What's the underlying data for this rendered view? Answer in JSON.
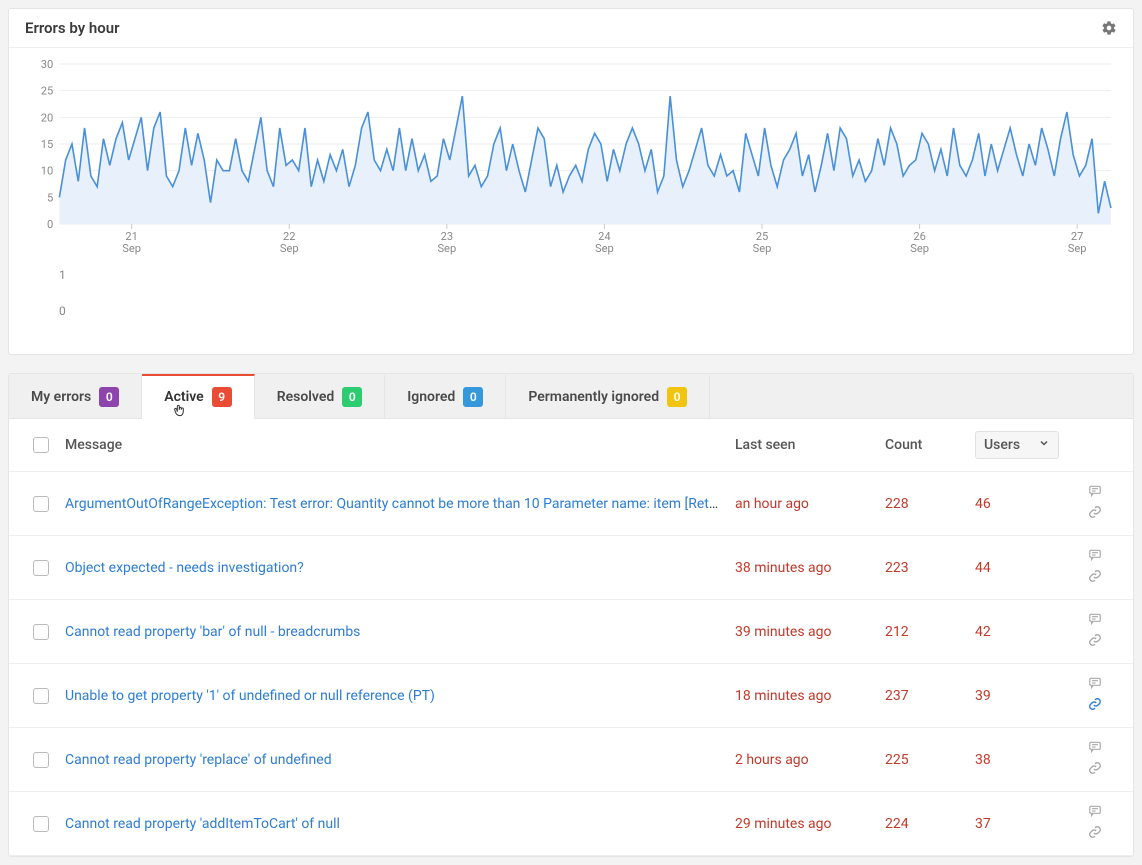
{
  "chart": {
    "title": "Errors by hour"
  },
  "chart_data": {
    "type": "line",
    "title": "Errors by hour",
    "ylabel": "",
    "xlabel": "",
    "ylim": [
      0,
      30
    ],
    "y_ticks": [
      0,
      5,
      10,
      15,
      20,
      25,
      30
    ],
    "x_ticks": [
      {
        "label_top": "21",
        "label_bottom": "Sep"
      },
      {
        "label_top": "22",
        "label_bottom": "Sep"
      },
      {
        "label_top": "23",
        "label_bottom": "Sep"
      },
      {
        "label_top": "24",
        "label_bottom": "Sep"
      },
      {
        "label_top": "25",
        "label_bottom": "Sep"
      },
      {
        "label_top": "26",
        "label_bottom": "Sep"
      },
      {
        "label_top": "27",
        "label_bottom": "Sep"
      }
    ],
    "secondary_axis_ticks": [
      "1",
      "0"
    ],
    "series": [
      {
        "name": "errors",
        "values": [
          5,
          12,
          15,
          8,
          18,
          9,
          7,
          16,
          11,
          16,
          19,
          12,
          16,
          20,
          10,
          18,
          21,
          9,
          7,
          10,
          18,
          11,
          17,
          12,
          4,
          12,
          10,
          10,
          16,
          10,
          8,
          14,
          20,
          10,
          7,
          18,
          11,
          12,
          10,
          18,
          7,
          12,
          8,
          13,
          10,
          14,
          7,
          11,
          18,
          21,
          12,
          10,
          14,
          10,
          18,
          10,
          16,
          10,
          13,
          8,
          9,
          16,
          12,
          18,
          24,
          9,
          11,
          7,
          9,
          15,
          18,
          10,
          15,
          10,
          6,
          12,
          18,
          16,
          7,
          11,
          6,
          9,
          11,
          8,
          14,
          17,
          15,
          8,
          14,
          10,
          15,
          18,
          15,
          10,
          14,
          6,
          9,
          24,
          12,
          7,
          10,
          14,
          18,
          11,
          9,
          13,
          9,
          10,
          6,
          17,
          13,
          9,
          18,
          11,
          7,
          12,
          14,
          17,
          9,
          13,
          6,
          11,
          17,
          10,
          18,
          16,
          9,
          12,
          8,
          10,
          16,
          11,
          18,
          15,
          9,
          11,
          12,
          17,
          15,
          10,
          14,
          9,
          18,
          11,
          9,
          12,
          17,
          9,
          15,
          10,
          14,
          18,
          13,
          9,
          15,
          11,
          18,
          14,
          9,
          16,
          21,
          13,
          9,
          11,
          16,
          2,
          8,
          3
        ]
      }
    ]
  },
  "tabs": [
    {
      "id": "my-errors",
      "label": "My errors",
      "badge": "0",
      "badge_color": "purple",
      "active": false
    },
    {
      "id": "active",
      "label": "Active",
      "badge": "9",
      "badge_color": "red",
      "active": true
    },
    {
      "id": "resolved",
      "label": "Resolved",
      "badge": "0",
      "badge_color": "green",
      "active": false
    },
    {
      "id": "ignored",
      "label": "Ignored",
      "badge": "0",
      "badge_color": "blue",
      "active": false
    },
    {
      "id": "perm-ignored",
      "label": "Permanently ignored",
      "badge": "0",
      "badge_color": "orange",
      "active": false
    }
  ],
  "table": {
    "headers": {
      "message": "Message",
      "last_seen": "Last seen",
      "count": "Count",
      "users": "Users"
    },
    "rows": [
      {
        "message": "ArgumentOutOfRangeException: Test error: Quantity cannot be more than 10 Parameter name: item [Returned …",
        "last_seen": "an hour ago",
        "count": "228",
        "users": "46",
        "link_highlight": false
      },
      {
        "message": "Object expected - needs investigation?",
        "last_seen": "38 minutes ago",
        "count": "223",
        "users": "44",
        "link_highlight": false
      },
      {
        "message": "Cannot read property 'bar' of null - breadcrumbs",
        "last_seen": "39 minutes ago",
        "count": "212",
        "users": "42",
        "link_highlight": false
      },
      {
        "message": "Unable to get property '1' of undefined or null reference (PT)",
        "last_seen": "18 minutes ago",
        "count": "237",
        "users": "39",
        "link_highlight": true
      },
      {
        "message": "Cannot read property 'replace' of undefined",
        "last_seen": "2 hours ago",
        "count": "225",
        "users": "38",
        "link_highlight": false
      },
      {
        "message": "Cannot read property 'addItemToCart' of null",
        "last_seen": "29 minutes ago",
        "count": "224",
        "users": "37",
        "link_highlight": false
      }
    ]
  }
}
